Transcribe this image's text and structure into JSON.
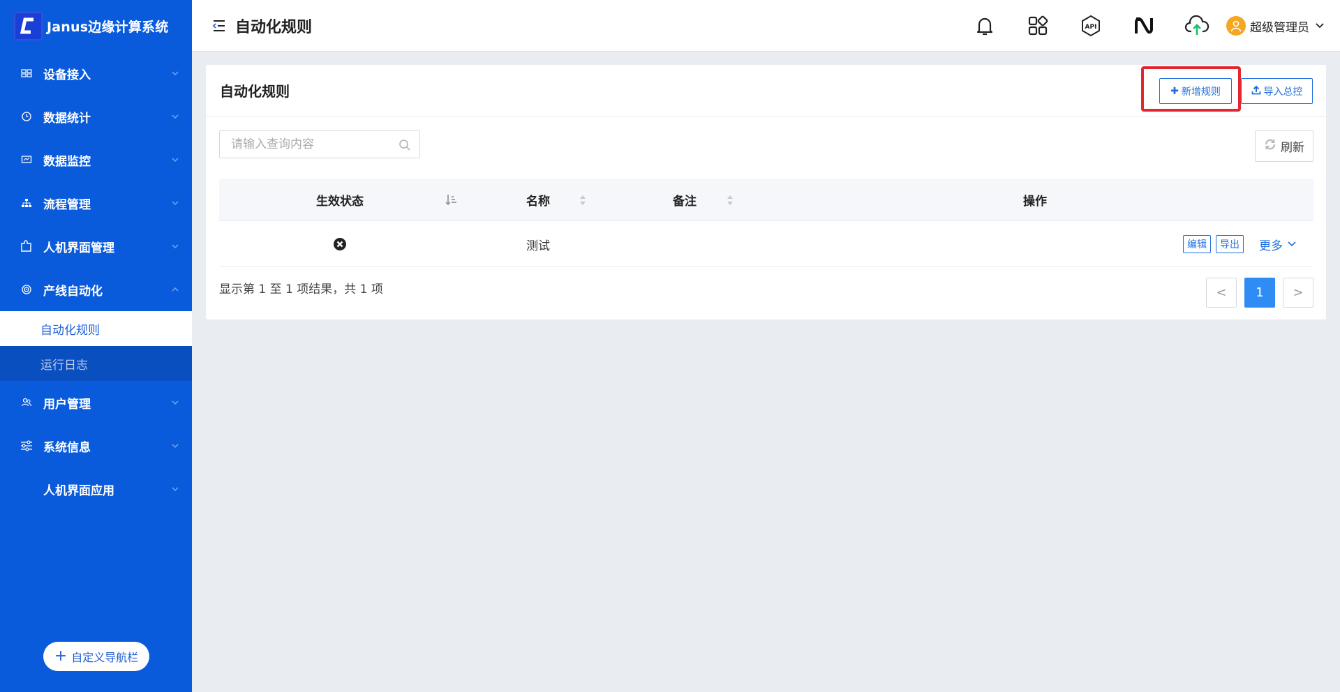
{
  "app": {
    "title": "Janus边缘计算系统"
  },
  "sidebar": {
    "items": [
      {
        "label": "设备接入"
      },
      {
        "label": "数据统计"
      },
      {
        "label": "数据监控"
      },
      {
        "label": "流程管理"
      },
      {
        "label": "人机界面管理"
      },
      {
        "label": "产线自动化"
      },
      {
        "label": "用户管理"
      },
      {
        "label": "系统信息"
      },
      {
        "label": "人机界面应用"
      }
    ],
    "sub_items": [
      {
        "label": "自动化规则"
      },
      {
        "label": "运行日志"
      }
    ],
    "custom_nav_label": "自定义导航栏"
  },
  "header": {
    "title": "自动化规则",
    "user_name": "超级管理员"
  },
  "card": {
    "title": "自动化规则",
    "add_rule_label": "新增规则",
    "import_label": "导入总控",
    "search_placeholder": "请输入查询内容",
    "refresh_label": "刷新"
  },
  "table": {
    "columns": [
      "生效状态",
      "名称",
      "备注",
      "操作"
    ],
    "rows": [
      {
        "status": "inactive",
        "name": "测试",
        "remark": "",
        "actions": [
          "编辑",
          "导出"
        ],
        "more": "更多"
      }
    ]
  },
  "pagination": {
    "summary": "显示第 1 至 1 项结果，共 1 项",
    "prev": "<",
    "current": "1",
    "next": ">"
  },
  "colors": {
    "sidebar_bg": "#0a5bdc",
    "primary": "#1f6fde",
    "page_active": "#2f8cf4",
    "highlight": "#e3262f"
  }
}
